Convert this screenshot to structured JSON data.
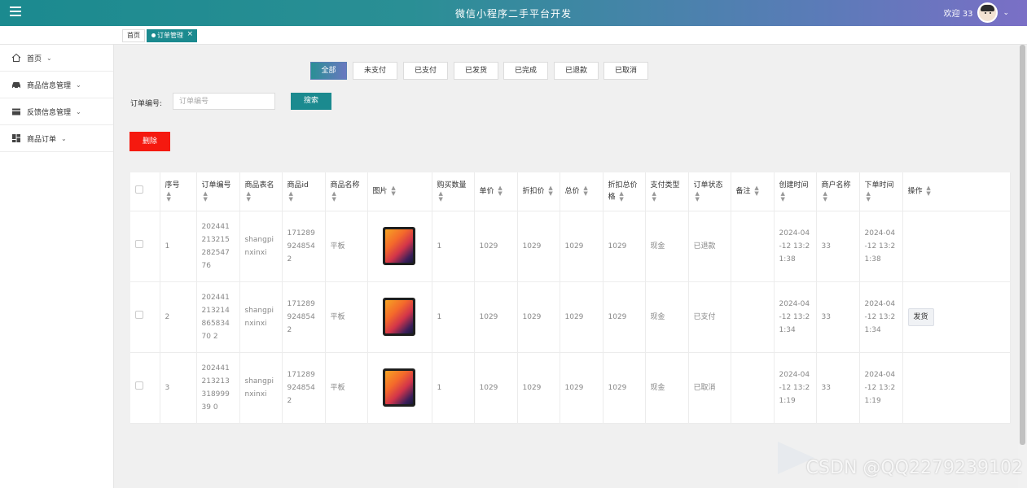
{
  "header": {
    "title": "微信小程序二手平台开发",
    "welcome": "欢迎 33"
  },
  "tabs": [
    {
      "label": "首页"
    },
    {
      "label": "订单管理",
      "close": "×"
    }
  ],
  "sidebar": {
    "items": [
      {
        "label": "首页",
        "icon": "home-icon"
      },
      {
        "label": "商品信息管理",
        "icon": "car-icon"
      },
      {
        "label": "反馈信息管理",
        "icon": "wallet-icon"
      },
      {
        "label": "商品订单",
        "icon": "grid-icon"
      }
    ]
  },
  "status_filters": [
    "全部",
    "未支付",
    "已支付",
    "已发货",
    "已完成",
    "已退款",
    "已取消"
  ],
  "search": {
    "label": "订单编号:",
    "placeholder": "订单编号",
    "button": "搜索"
  },
  "delete_label": "删除",
  "table": {
    "columns": [
      "序号",
      "订单编号",
      "商品表名",
      "商品id",
      "商品名称",
      "图片",
      "购买数量",
      "单价",
      "折扣价",
      "总价",
      "折扣总价格",
      "支付类型",
      "订单状态",
      "备注",
      "创建时间",
      "商户名称",
      "下单时间",
      "操作"
    ],
    "rows": [
      {
        "index": "1",
        "order_no": "20244121321528254776",
        "table": "shangpinxinxi",
        "goods_id": "1712899248542",
        "name": "平板",
        "qty": "1",
        "price": "1029",
        "discount": "1029",
        "total": "1029",
        "discount_total": "1029",
        "pay_type": "现金",
        "status": "已退款",
        "remark": "",
        "created": "2024-04-12 13:21:38",
        "merchant": "33",
        "ordered": "2024-04-12 13:21:38",
        "action": ""
      },
      {
        "index": "2",
        "order_no": "20244121321486583470 2",
        "table": "shangpinxinxi",
        "goods_id": "1712899248542",
        "name": "平板",
        "qty": "1",
        "price": "1029",
        "discount": "1029",
        "total": "1029",
        "discount_total": "1029",
        "pay_type": "现金",
        "status": "已支付",
        "remark": "",
        "created": "2024-04-12 13:21:34",
        "merchant": "33",
        "ordered": "2024-04-12 13:21:34",
        "action": "发货"
      },
      {
        "index": "3",
        "order_no": "20244121321331899939 0",
        "table": "shangpinxinxi",
        "goods_id": "1712899248542",
        "name": "平板",
        "qty": "1",
        "price": "1029",
        "discount": "1029",
        "total": "1029",
        "discount_total": "1029",
        "pay_type": "现金",
        "status": "已取消",
        "remark": "",
        "created": "2024-04-12 13:21:19",
        "merchant": "33",
        "ordered": "2024-04-12 13:21:19",
        "action": ""
      }
    ]
  },
  "watermark": "CSDN @QQ2279239102",
  "colors": {
    "primary": "#1b8a8f",
    "danger": "#f5190f",
    "accent": "#6a78c0"
  }
}
